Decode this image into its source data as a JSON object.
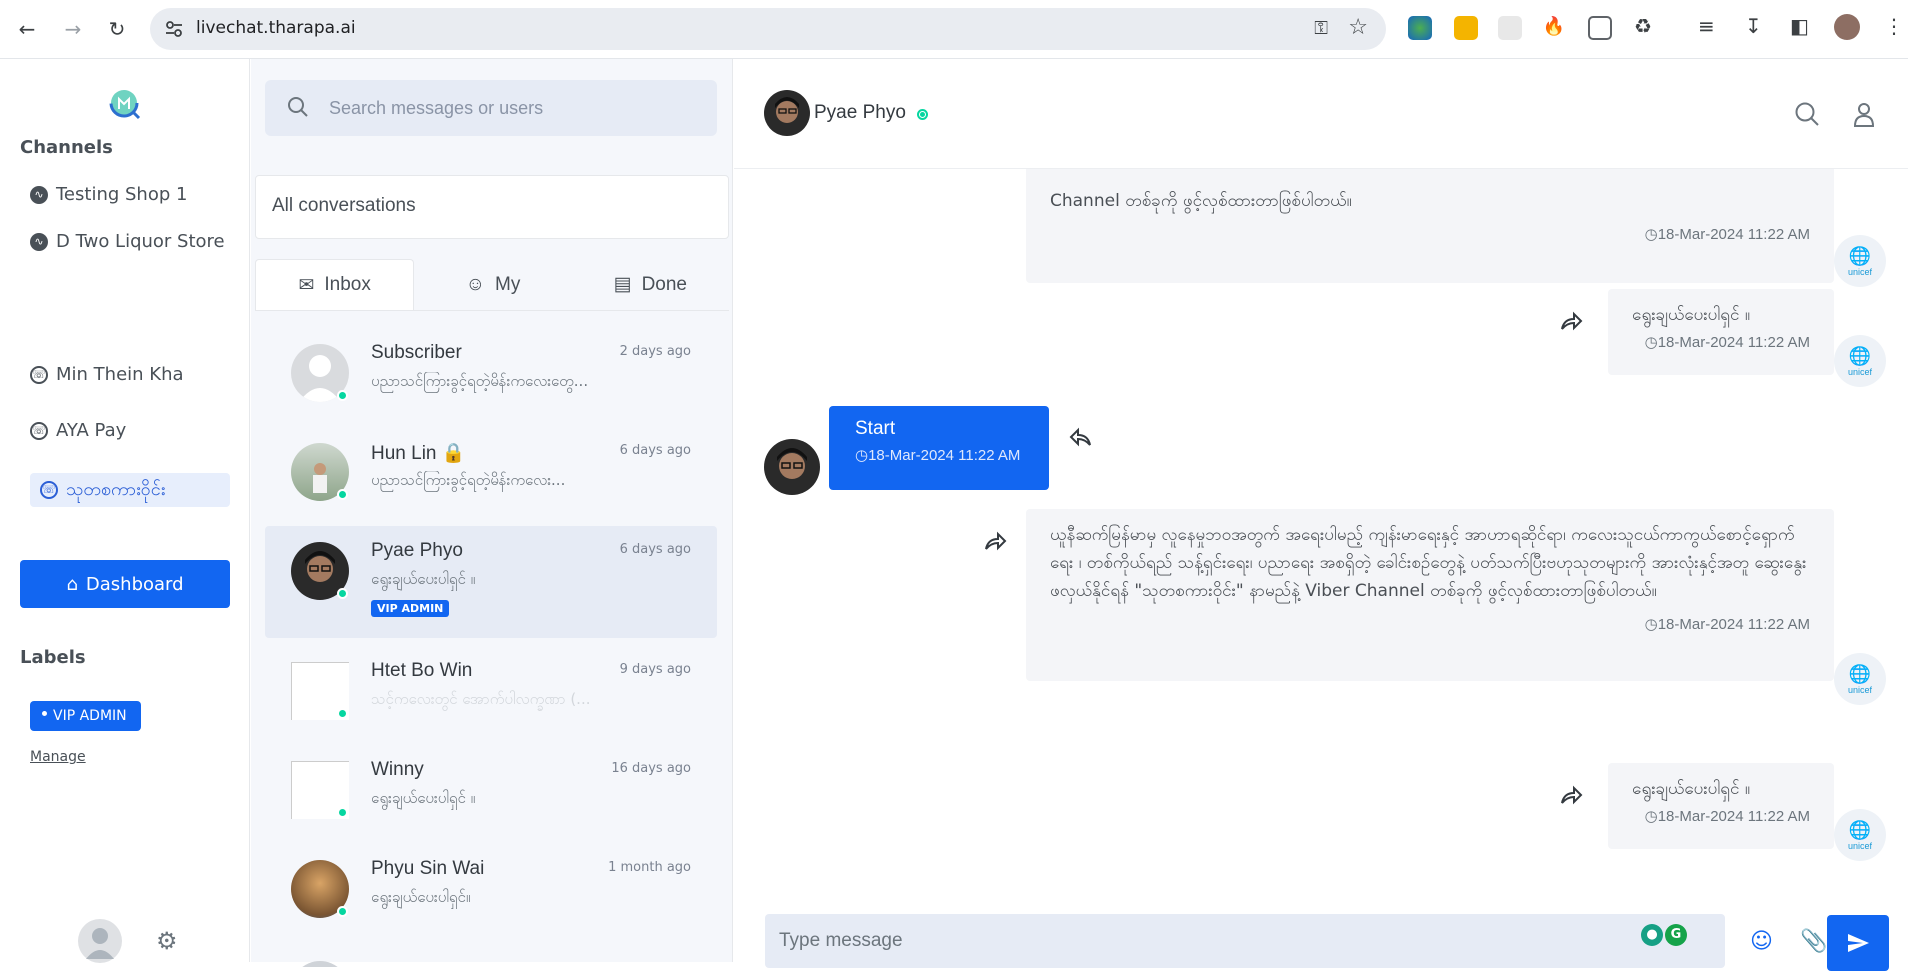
{
  "browser": {
    "url": "livechat.tharapa.ai"
  },
  "sidebar": {
    "channels_title": "Channels",
    "channels": [
      {
        "label": "Testing Shop 1",
        "icon": "messenger-icon"
      },
      {
        "label": "D Two Liquor Store",
        "icon": "messenger-icon"
      },
      {
        "label": "Min Thein Kha",
        "icon": "viber-icon"
      },
      {
        "label": "AYA Pay",
        "icon": "viber-icon"
      },
      {
        "label": "သုတစကားဝိုင်း",
        "icon": "viber-icon"
      }
    ],
    "dashboard_label": "Dashboard",
    "labels_title": "Labels",
    "label_pill": "VIP ADMIN",
    "manage_label": "Manage"
  },
  "conversations": {
    "search_placeholder": "Search messages or users",
    "filter": "All conversations",
    "tabs": [
      {
        "label": "Inbox",
        "icon": "mail-icon"
      },
      {
        "label": "My",
        "icon": "user-icon"
      },
      {
        "label": "Done",
        "icon": "archive-icon"
      }
    ],
    "items": [
      {
        "name": "Subscriber",
        "time": "2 days ago",
        "message": "ပညာသင်ကြားခွင့်ရတဲ့မိန်းကလေးတွေ..."
      },
      {
        "name": "Hun Lin",
        "time": "6 days ago",
        "message": "ပညာသင်ကြားခွင့်ရတဲ့မိန်းကလေး..."
      },
      {
        "name": "Pyae Phyo",
        "time": "6 days ago",
        "message": "ရွေးချယ်ပေးပါရှင် ။",
        "badge": "VIP ADMIN"
      },
      {
        "name": "Htet Bo Win",
        "time": "9 days ago",
        "message": "သင့်ကလေးတွင် အောက်ပါလက္ခဏာ (..."
      },
      {
        "name": "Winny",
        "time": "16 days ago",
        "message": "ရွေးချယ်ပေးပါရှင် ။"
      },
      {
        "name": "Phyu Sin Wai",
        "time": "1 month ago",
        "message": "ရွေးချယ်ပေးပါရှင်။"
      }
    ]
  },
  "chat": {
    "contact_name": "Pyae Phyo",
    "messages": [
      {
        "type": "incoming",
        "text": "Channel တစ်ခုကို ဖွင့်လှစ်ထားတာဖြစ်ပါတယ်။",
        "time": "18-Mar-2024 11:22 AM"
      },
      {
        "type": "incoming",
        "text": "ရွေးချယ်ပေးပါရှင် ။",
        "time": "18-Mar-2024 11:22 AM"
      },
      {
        "type": "outgoing",
        "text": "Start",
        "time": "18-Mar-2024 11:22 AM"
      },
      {
        "type": "incoming",
        "text": "ယူနီဆက်မြန်မာမှ လူနေမှုဘဝအတွက် အရေးပါမည့် ကျန်းမာရေးနှင့် အာဟာရဆိုင်ရာ၊ ကလေးသူငယ်ကာကွယ်စောင့်ရှောက်ရေး ၊ တစ်ကိုယ်ရည် သန့်ရှင်းရေး၊ ပညာရေး အစရှိတဲ့ ခေါင်းစဉ်တွေနဲ့ ပတ်သက်ပြီးဗဟုသုတများကို အားလုံးနှင့်အတူ ဆွေးနွေး ဖလှယ်နိုင်ရန် \"သုတစကားဝိုင်း\" နာမည်နဲ့ Viber Channel တစ်ခုကို ဖွင့်လှစ်ထားတာဖြစ်ပါတယ်။",
        "time": "18-Mar-2024 11:22 AM"
      },
      {
        "type": "incoming",
        "text": "ရွေးချယ်ပေးပါရှင် ။",
        "time": "18-Mar-2024 11:22 AM"
      }
    ],
    "sender_logo_text": "unicef",
    "composer_placeholder": "Type message"
  },
  "colors": {
    "primary": "#1266f1",
    "online": "#06d6a0"
  }
}
